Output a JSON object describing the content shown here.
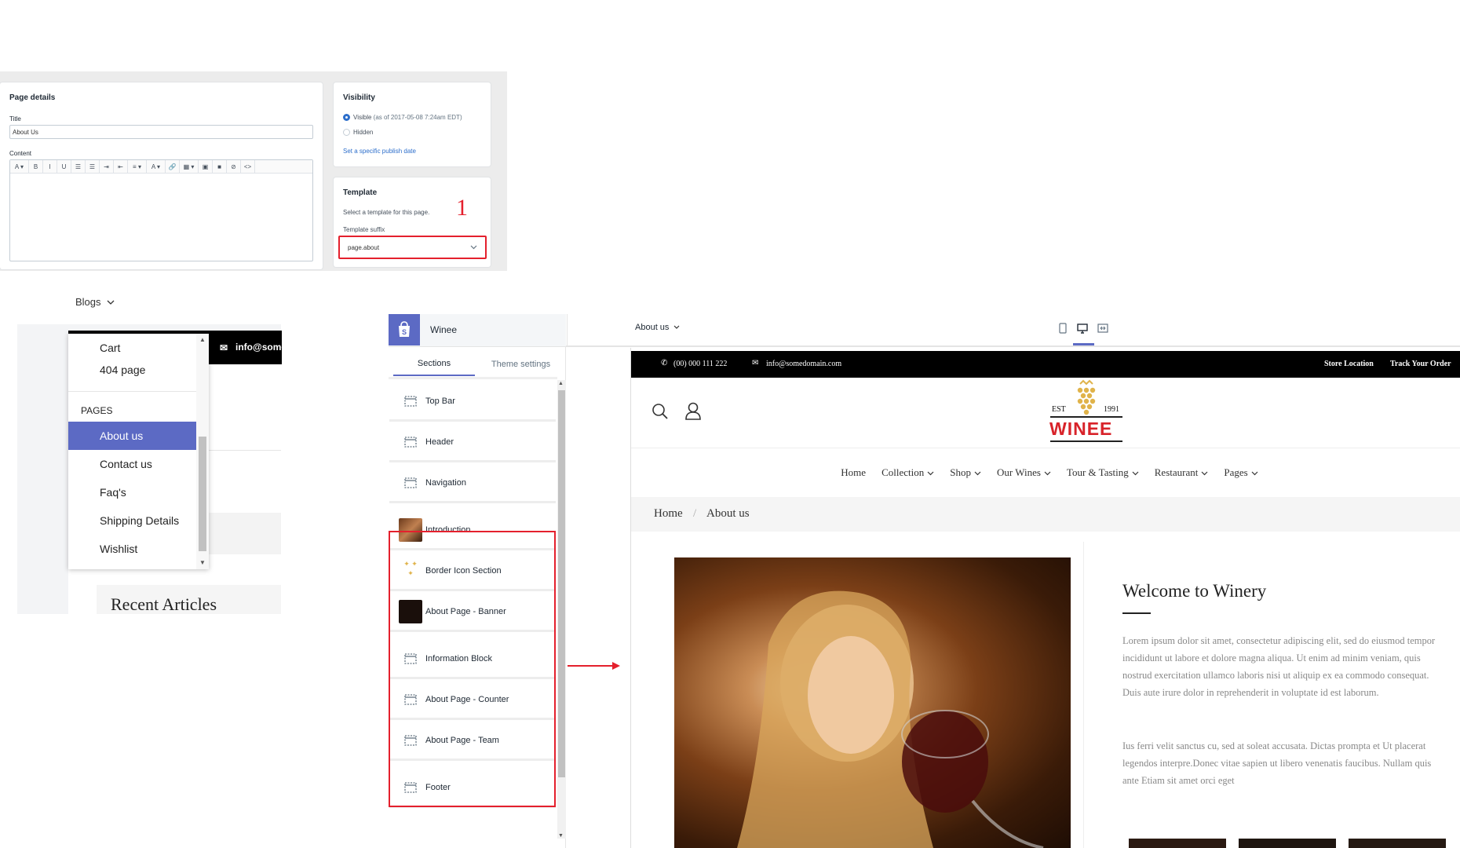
{
  "editor": {
    "page_details": {
      "heading": "Page details",
      "title_label": "Title",
      "title_value": "About Us",
      "content_label": "Content",
      "toolbar": [
        "A ▾",
        "B",
        "I",
        "U",
        "☰",
        "☰",
        "⇥",
        "⇤",
        "≡ ▾",
        "A ▾",
        "🔗",
        "▦ ▾",
        "▣",
        "■",
        "⊘",
        "<>"
      ]
    },
    "visibility": {
      "heading": "Visibility",
      "visible_label": "Visible",
      "visible_note": "(as of 2017-05-08 7:24am EDT)",
      "hidden_label": "Hidden",
      "publish_link": "Set a specific publish date"
    },
    "template": {
      "heading": "Template",
      "help": "Select a template for this page.",
      "suffix_label": "Template suffix",
      "selected": "page.about",
      "annotation": "1"
    }
  },
  "blog_menu": {
    "trigger": "Blogs",
    "black_bar_email": "info@some",
    "items": [
      "Cart",
      "404 page"
    ],
    "section_label": "PAGES",
    "pages": [
      {
        "label": "About us",
        "selected": true
      },
      {
        "label": "Contact us",
        "selected": false
      },
      {
        "label": "Faq's",
        "selected": false
      },
      {
        "label": "Shipping Details",
        "selected": false
      },
      {
        "label": "Wishlist",
        "selected": false
      }
    ],
    "recent_articles": "Recent Articles"
  },
  "theme_editor": {
    "store_name": "Winee",
    "page_select": "About us",
    "tabs": [
      "Sections",
      "Theme settings"
    ],
    "active_tab": 0,
    "sections": [
      {
        "label": "Top Bar",
        "icon": "section-icon"
      },
      {
        "label": "Header",
        "icon": "section-icon"
      },
      {
        "label": "Navigation",
        "icon": "section-icon"
      },
      {
        "label": "Introduction",
        "icon": "photo-thumb"
      },
      {
        "label": "Border Icon Section",
        "icon": "icons-thumb"
      },
      {
        "label": "About Page - Banner",
        "icon": "dark-thumb"
      },
      {
        "label": "Information Block",
        "icon": "section-icon"
      },
      {
        "label": "About Page - Counter",
        "icon": "section-icon"
      },
      {
        "label": "About Page - Team",
        "icon": "section-icon"
      },
      {
        "label": "Footer",
        "icon": "section-icon"
      }
    ]
  },
  "site": {
    "phone": "(00) 000 111 222",
    "email": "info@somedomain.com",
    "top_links": [
      "Store Location",
      "Track Your Order"
    ],
    "logo": {
      "est": "EST",
      "year": "1991",
      "name": "WINEE"
    },
    "nav": [
      {
        "label": "Home",
        "dropdown": false
      },
      {
        "label": "Collection",
        "dropdown": true
      },
      {
        "label": "Shop",
        "dropdown": true
      },
      {
        "label": "Our Wines",
        "dropdown": true
      },
      {
        "label": "Tour & Tasting",
        "dropdown": true
      },
      {
        "label": "Restaurant",
        "dropdown": true
      },
      {
        "label": "Pages",
        "dropdown": true
      }
    ],
    "breadcrumb": [
      "Home",
      "About us"
    ],
    "breadcrumb_sep": "/",
    "welcome_title": "Welcome to Winery",
    "para1": "Lorem ipsum dolor sit amet, consectetur adipiscing elit, sed do eiusmod tempor incididunt ut labore et dolore magna aliqua. Ut enim ad minim veniam, quis nostrud exercitation ullamco laboris nisi ut aliquip ex ea commodo consequat. Duis aute irure dolor in reprehenderit in voluptate id est laborum.",
    "para2": "Ius ferri velit sanctus cu, sed at soleat accusata. Dictas prompta et Ut placerat legendos interpre.Donec vitae sapien ut libero venenatis faucibus. Nullam quis ante Etiam sit amet orci eget"
  },
  "colors": {
    "accent": "#5c6ac4",
    "highlight": "#e4202d",
    "logo_red": "#d8232a",
    "logo_gold": "#e0b34a"
  }
}
